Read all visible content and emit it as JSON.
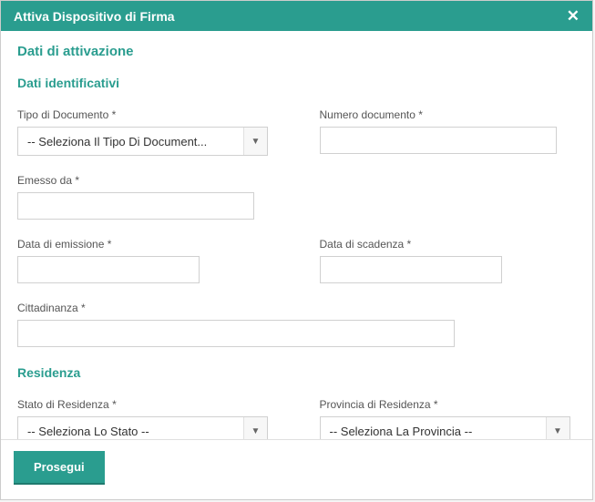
{
  "header": {
    "title": "Attiva Dispositivo di Firma"
  },
  "sections": {
    "activation": "Dati di attivazione",
    "identity": "Dati identificativi",
    "residence": "Residenza"
  },
  "fields": {
    "docType": {
      "label": "Tipo di Documento *",
      "selected": "-- Seleziona Il Tipo Di Document..."
    },
    "docNumber": {
      "label": "Numero documento *",
      "value": ""
    },
    "issuedBy": {
      "label": "Emesso da *",
      "value": ""
    },
    "issueDate": {
      "label": "Data di emissione *",
      "value": ""
    },
    "expiryDate": {
      "label": "Data di scadenza *",
      "value": ""
    },
    "citizenship": {
      "label": "Cittadinanza *",
      "value": ""
    },
    "residenceState": {
      "label": "Stato di Residenza *",
      "selected": "-- Seleziona Lo Stato --"
    },
    "residenceProvince": {
      "label": "Provincia di Residenza *",
      "selected": "-- Seleziona La Provincia --"
    }
  },
  "footer": {
    "proceed": "Prosegui"
  }
}
